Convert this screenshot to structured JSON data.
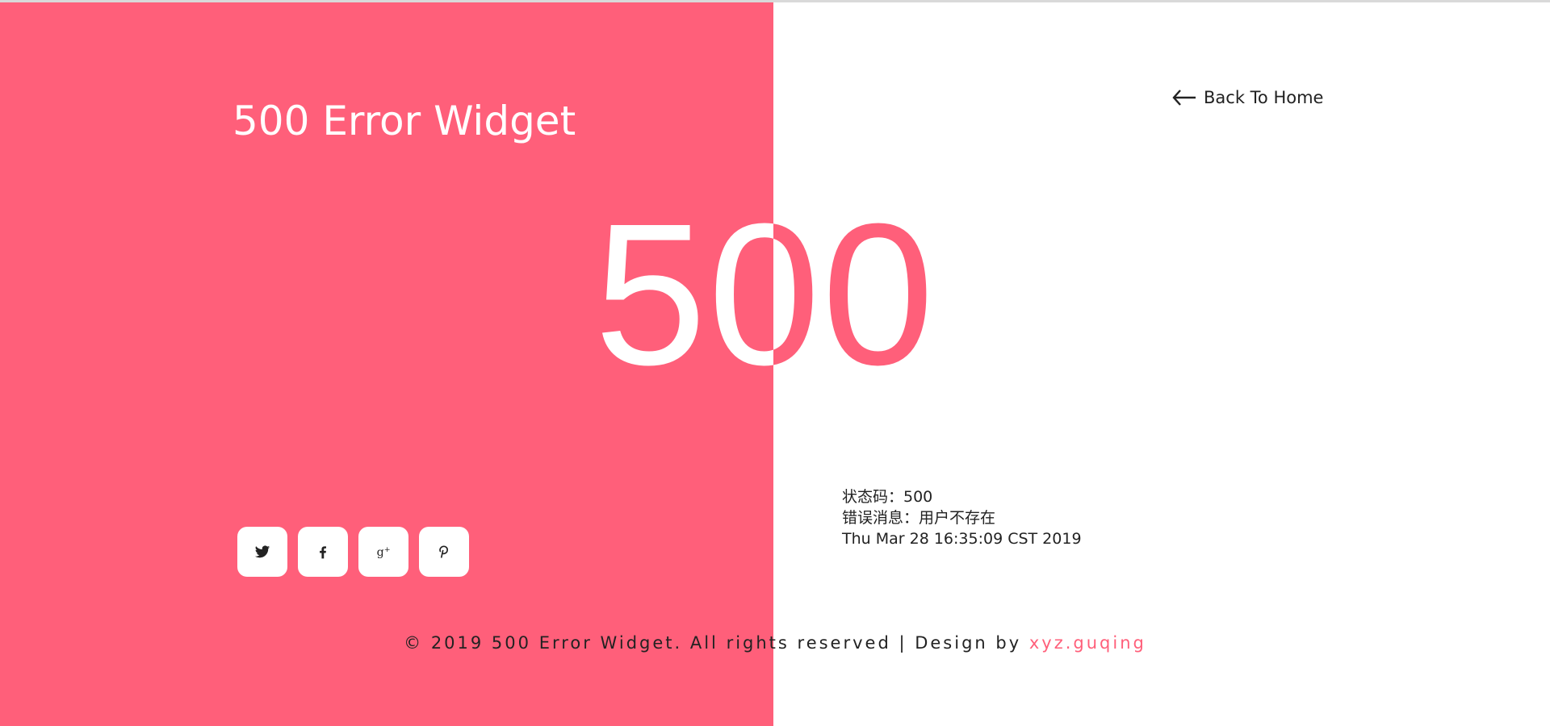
{
  "header": {
    "title": "500 Error Widget",
    "back_link": "Back To Home"
  },
  "error": {
    "code": "500",
    "status_line": "状态码：500",
    "message_line": "错误消息：用户不存在",
    "timestamp": "Thu Mar 28 16:35:09 CST 2019"
  },
  "social": [
    {
      "name": "twitter-icon"
    },
    {
      "name": "facebook-icon"
    },
    {
      "name": "google-plus-icon"
    },
    {
      "name": "pinterest-icon"
    }
  ],
  "footer": {
    "text": "© 2019 500 Error Widget. All rights reserved | Design by ",
    "designer": "xyz.guqing"
  },
  "colors": {
    "accent": "#ff5f7a",
    "text": "#222222",
    "background": "#ffffff"
  }
}
